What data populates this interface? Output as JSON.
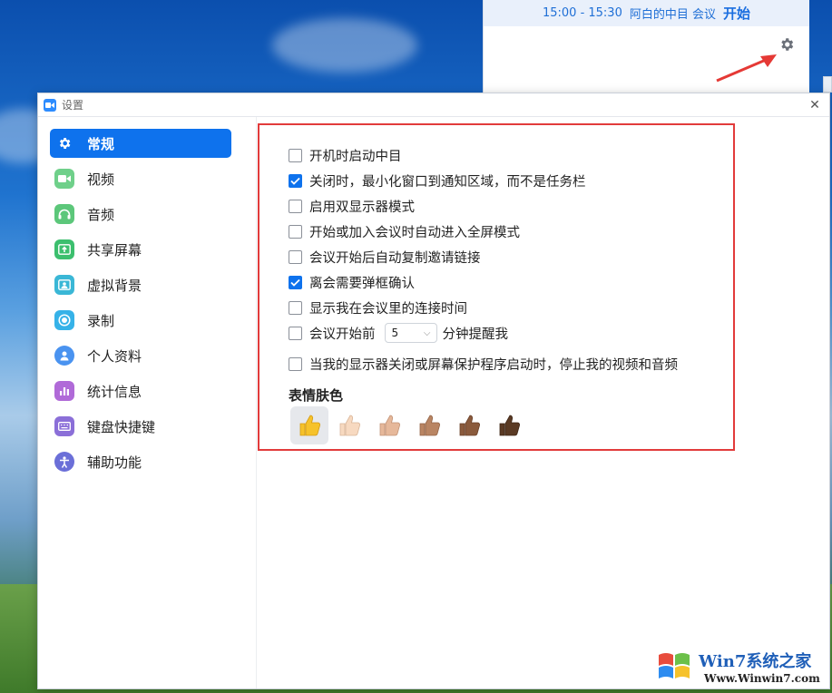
{
  "meeting": {
    "time_range": "15:00 - 15:30",
    "title": "阿白的中目 会议",
    "start_label": "开始"
  },
  "window": {
    "title": "设置"
  },
  "sidebar": {
    "items": [
      {
        "label": "常规",
        "icon": "gear-icon",
        "color": "#ffffff",
        "active": true
      },
      {
        "label": "视频",
        "icon": "video-camera-icon",
        "color": "#6fd08a"
      },
      {
        "label": "音频",
        "icon": "headphones-icon",
        "color": "#5cc77a"
      },
      {
        "label": "共享屏幕",
        "icon": "share-screen-icon",
        "color": "#3cbf6e"
      },
      {
        "label": "虚拟背景",
        "icon": "virtual-background-icon",
        "color": "#3ab7d6"
      },
      {
        "label": "录制",
        "icon": "record-icon",
        "color": "#36b2e8"
      },
      {
        "label": "个人资料",
        "icon": "profile-icon",
        "color": "#4a93f0"
      },
      {
        "label": "统计信息",
        "icon": "statistics-icon",
        "color": "#b06ad8"
      },
      {
        "label": "键盘快捷键",
        "icon": "keyboard-icon",
        "color": "#8b6fd8"
      },
      {
        "label": "辅助功能",
        "icon": "accessibility-icon",
        "color": "#6b6fd8"
      }
    ]
  },
  "general": {
    "options": [
      {
        "label": "开机时启动中目",
        "checked": false
      },
      {
        "label": "关闭时，最小化窗口到通知区域，而不是任务栏",
        "checked": true
      },
      {
        "label": "启用双显示器模式",
        "checked": false
      },
      {
        "label": "开始或加入会议时自动进入全屏模式",
        "checked": false
      },
      {
        "label": "会议开始后自动复制邀请链接",
        "checked": false
      },
      {
        "label": "离会需要弹框确认",
        "checked": true
      },
      {
        "label": "显示我在会议里的连接时间",
        "checked": false
      }
    ],
    "reminder": {
      "before_label": "会议开始前",
      "value": "5",
      "after_label": "分钟提醒我",
      "checked": false
    },
    "screensaver_option": {
      "label": "当我的显示器关闭或屏幕保护程序启动时，停止我的视频和音频",
      "checked": false
    },
    "skin_tone_title": "表情肤色",
    "skin_tones": [
      {
        "name": "default",
        "color": "#f6c22b",
        "selected": true
      },
      {
        "name": "light",
        "color": "#f7d9c0"
      },
      {
        "name": "medium-light",
        "color": "#e6b89a"
      },
      {
        "name": "medium",
        "color": "#b98563"
      },
      {
        "name": "medium-dark",
        "color": "#8a5a3c"
      },
      {
        "name": "dark",
        "color": "#5a3a24"
      }
    ]
  },
  "watermark": {
    "brand": "Win7系统之家",
    "url": "Www.Winwin7.com"
  }
}
